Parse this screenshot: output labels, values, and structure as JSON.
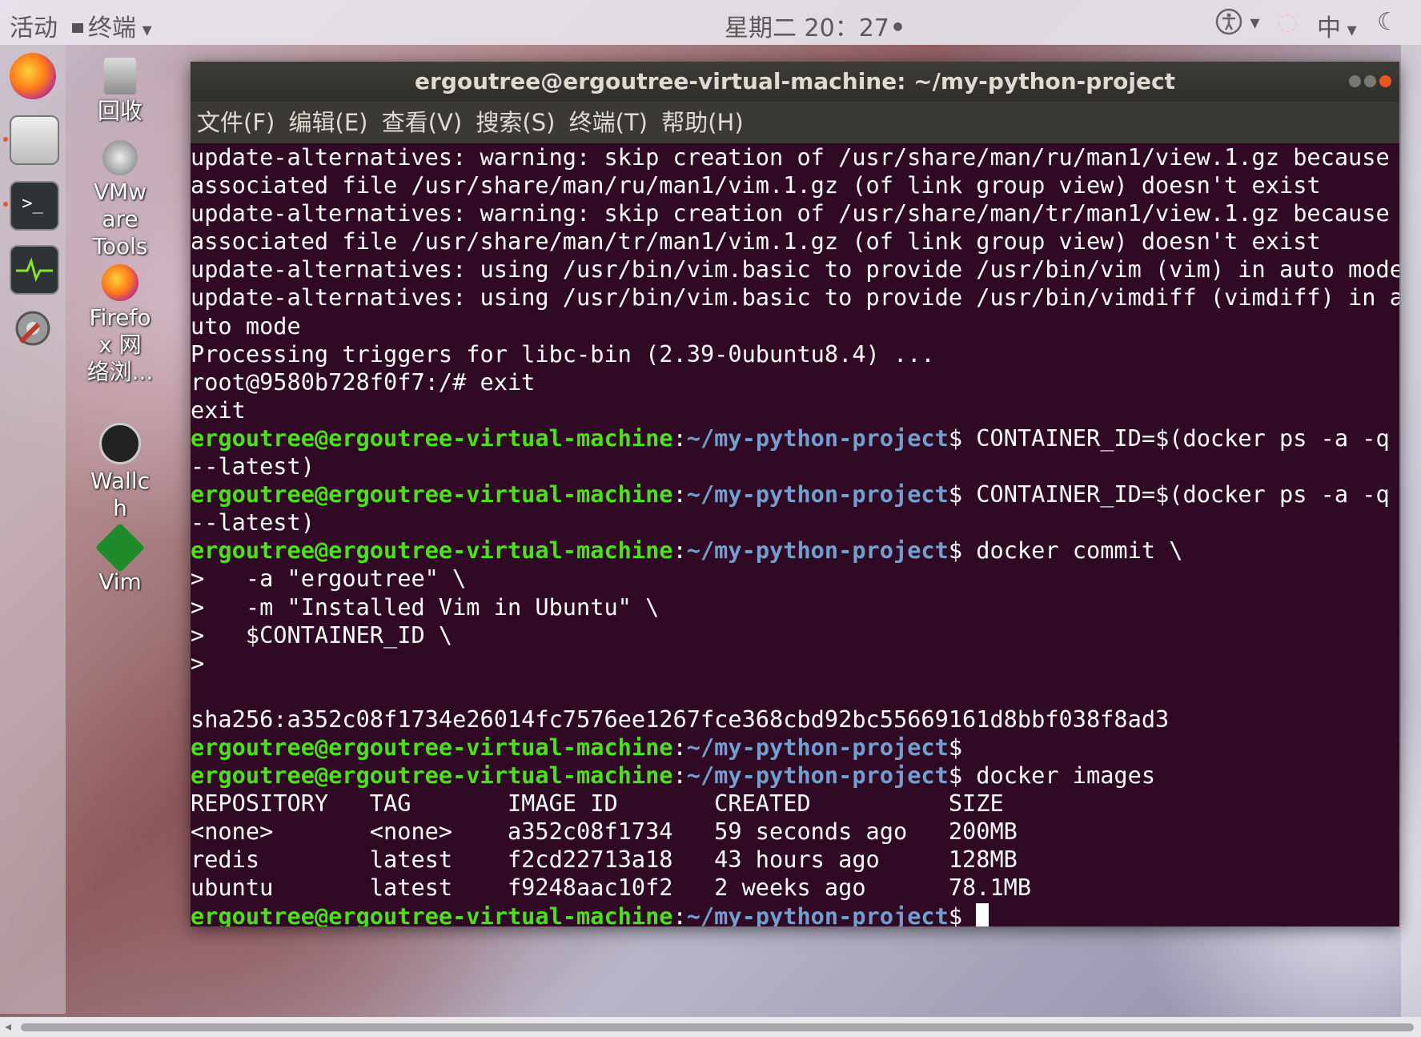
{
  "topbar": {
    "activities": "活动",
    "app_menu": "终端",
    "clock": "星期二 20：27",
    "input_method": "中"
  },
  "desktop_icons": [
    {
      "label_lines": [
        "回收"
      ]
    },
    {
      "label_lines": [
        "VMw",
        "are",
        "Tools"
      ]
    },
    {
      "label_lines": [
        "Firefo",
        "x 网",
        "络浏..."
      ]
    },
    {
      "label_lines": [
        "Wallc",
        "h"
      ]
    },
    {
      "label_lines": [
        "Vim"
      ]
    }
  ],
  "window": {
    "title": "ergoutree@ergoutree-virtual-machine: ~/my-python-project",
    "menu": [
      "文件(F)",
      "编辑(E)",
      "查看(V)",
      "搜索(S)",
      "终端(T)",
      "帮助(H)"
    ]
  },
  "prompt": {
    "user_host": "ergoutree@ergoutree-virtual-machine",
    "sep": ":",
    "path": "~/my-python-project",
    "dollar": "$"
  },
  "terminal_lines": [
    {
      "text": "update-alternatives: warning: skip creation of /usr/share/man/ru/man1/view.1.gz because"
    },
    {
      "text": "associated file /usr/share/man/ru/man1/vim.1.gz (of link group view) doesn't exist"
    },
    {
      "text": "update-alternatives: warning: skip creation of /usr/share/man/tr/man1/view.1.gz because"
    },
    {
      "text": "associated file /usr/share/man/tr/man1/vim.1.gz (of link group view) doesn't exist"
    },
    {
      "text": "update-alternatives: using /usr/bin/vim.basic to provide /usr/bin/vim (vim) in auto mode"
    },
    {
      "text": "update-alternatives: using /usr/bin/vim.basic to provide /usr/bin/vimdiff (vimdiff) in a"
    },
    {
      "text": "uto mode"
    },
    {
      "text": "Processing triggers for libc-bin (2.39-0ubuntu8.4) ..."
    },
    {
      "text": "root@9580b728f0f7:/# exit"
    },
    {
      "text": "exit"
    },
    {
      "prompt": true,
      "text": " CONTAINER_ID=$(docker ps -a -q"
    },
    {
      "text": "--latest)"
    },
    {
      "prompt": true,
      "text": " CONTAINER_ID=$(docker ps -a -q"
    },
    {
      "text": "--latest)"
    },
    {
      "prompt": true,
      "text": " docker commit \\"
    },
    {
      "text": ">   -a \"ergoutree\" \\"
    },
    {
      "text": ">   -m \"Installed Vim in Ubuntu\" \\"
    },
    {
      "text": ">   $CONTAINER_ID \\"
    },
    {
      "text": ">"
    },
    {
      "text": ""
    },
    {
      "text": "sha256:a352c08f1734e26014fc7576ee1267fce368cbd92bc55669161d8bbf038f8ad3"
    },
    {
      "prompt": true,
      "text": ""
    },
    {
      "prompt": true,
      "text": " docker images"
    },
    {
      "text": "REPOSITORY   TAG       IMAGE ID       CREATED          SIZE"
    },
    {
      "text": "<none>       <none>    a352c08f1734   59 seconds ago   200MB"
    },
    {
      "text": "redis        latest    f2cd22713a18   43 hours ago     128MB"
    },
    {
      "text": "ubuntu       latest    f9248aac10f2   2 weeks ago      78.1MB"
    },
    {
      "prompt": true,
      "text": " ",
      "cursor": true
    }
  ],
  "colors": {
    "terminal_bg": "#300a24",
    "prompt_user": "#4ce01b",
    "prompt_path": "#729fcf"
  }
}
